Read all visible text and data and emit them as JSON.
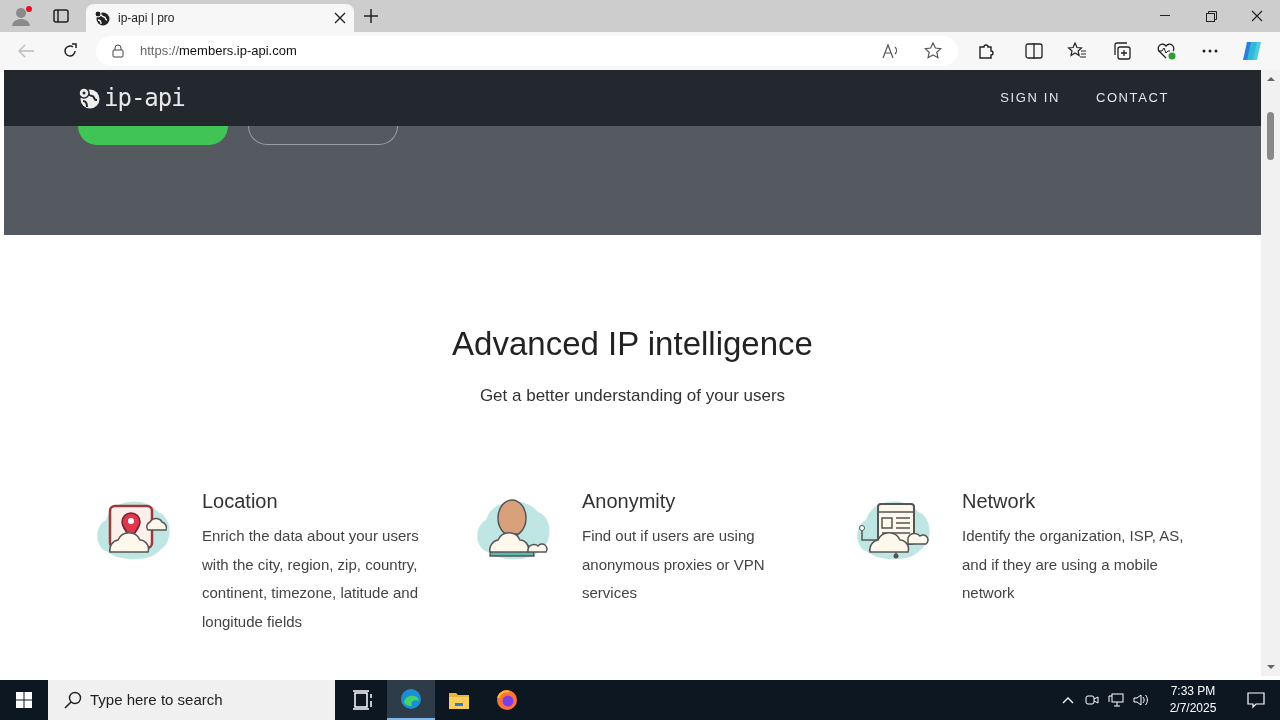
{
  "browser": {
    "tab_title": "ip-api | pro",
    "url_scheme": "https://",
    "url_host": "members.ip-api.com"
  },
  "navbar": {
    "logo": "ip-api",
    "links": [
      "SIGN IN",
      "CONTACT"
    ]
  },
  "hero": {
    "buttons": [
      {
        "kind": "filled"
      },
      {
        "kind": "outline"
      }
    ]
  },
  "section": {
    "title": "Advanced IP intelligence",
    "subtitle": "Get a better understanding of your users",
    "features": [
      {
        "kind": "location",
        "title": "Location",
        "text": "Enrich the data about your users with the city, region, zip, country, continent, timezone, latitude and longitude fields"
      },
      {
        "kind": "anonymity",
        "title": "Anonymity",
        "text": "Find out if users are using anonymous proxies or VPN services"
      },
      {
        "kind": "network",
        "title": "Network",
        "text": "Identify the organization, ISP, AS, and if they are using a mobile network"
      }
    ]
  },
  "taskbar": {
    "search_placeholder": "Type here to search",
    "apps": [
      {
        "kind": "taskview",
        "selected": false
      },
      {
        "kind": "edge",
        "selected": true
      },
      {
        "kind": "folder",
        "selected": false
      },
      {
        "kind": "firefox",
        "selected": false
      }
    ],
    "time": "7:33 PM",
    "date": "2/7/2025"
  }
}
